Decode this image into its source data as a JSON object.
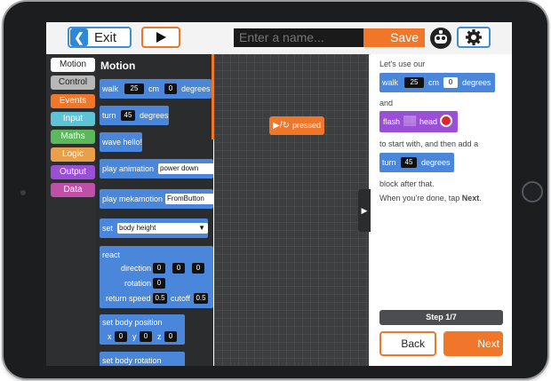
{
  "toolbar": {
    "exit_label": "Exit",
    "name_placeholder": "Enter a name...",
    "save_label": "Save"
  },
  "categories": [
    {
      "label": "Motion",
      "color": "#ffffff",
      "text": "#222222"
    },
    {
      "label": "Control",
      "color": "#b8b8b8",
      "text": "#222222"
    },
    {
      "label": "Events",
      "color": "#f0772a",
      "text": "#ffffff"
    },
    {
      "label": "Input",
      "color": "#5ec3d4",
      "text": "#ffffff"
    },
    {
      "label": "Maths",
      "color": "#5cb85c",
      "text": "#ffffff"
    },
    {
      "label": "Logic",
      "color": "#e8a14a",
      "text": "#ffffff"
    },
    {
      "label": "Output",
      "color": "#9b4fd6",
      "text": "#ffffff"
    },
    {
      "label": "Data",
      "color": "#c04fa8",
      "text": "#ffffff"
    }
  ],
  "palette": {
    "title": "Motion",
    "walk": {
      "label": "walk",
      "value": "25",
      "unit": "cm",
      "angle": "0",
      "angle_unit": "degrees"
    },
    "turn": {
      "label": "turn",
      "value": "45",
      "unit": "degrees"
    },
    "wave": {
      "label": "wave hello!"
    },
    "play_animation": {
      "label": "play animation",
      "value": "power down"
    },
    "play_mekamotion": {
      "label": "play mekamotion",
      "value": "FromButton"
    },
    "set": {
      "label": "set",
      "value": "body height"
    },
    "react": {
      "label": "react",
      "direction_label": "direction",
      "direction_values": [
        "0",
        "0",
        "0"
      ],
      "rotation_label": "rotation",
      "rotation_value": "0",
      "return_speed_label": "return speed",
      "return_speed_value": "0.5",
      "cutoff_label": "cutoff",
      "cutoff_value": "0.5"
    },
    "set_body_position": {
      "label": "set body position",
      "x_label": "x",
      "x": "0",
      "y_label": "y",
      "y": "0",
      "z_label": "z",
      "z": "0"
    },
    "set_body_rotation": {
      "label": "set body rotation"
    }
  },
  "workspace": {
    "block_label": "pressed"
  },
  "tutorial": {
    "intro": "Let's use our",
    "walk": {
      "label": "walk",
      "value": "25",
      "unit": "cm",
      "angle": "0",
      "angle_unit": "degrees"
    },
    "and": "and",
    "flash": {
      "label": "flash",
      "part": "head"
    },
    "start_text": "to start with, and then add a",
    "turn": {
      "label": "turn",
      "value": "45",
      "unit": "degrees"
    },
    "after_text": "block after that.",
    "done_prefix": "When you're done, tap ",
    "done_bold": "Next",
    "done_suffix": ".",
    "step": "Step 1/7",
    "back_label": "Back",
    "next_label": "Next"
  }
}
